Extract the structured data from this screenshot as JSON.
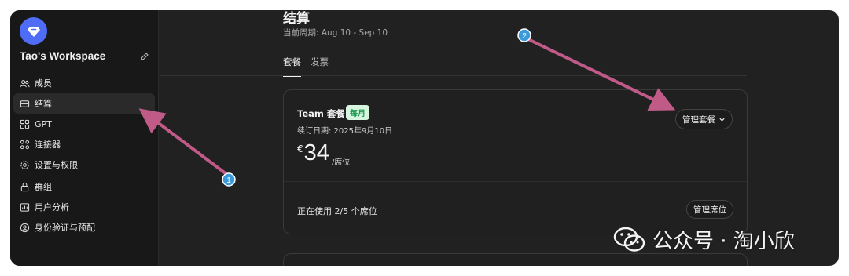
{
  "sidebar": {
    "workspace_name": "Tao's Workspace",
    "items": [
      {
        "label": "成员",
        "icon": "members-icon"
      },
      {
        "label": "结算",
        "icon": "card-icon",
        "active": true
      },
      {
        "label": "GPT",
        "icon": "gpt-icon"
      },
      {
        "label": "连接器",
        "icon": "connector-icon"
      },
      {
        "label": "设置与权限",
        "icon": "gear-icon"
      },
      {
        "label": "群组",
        "icon": "lock-icon"
      },
      {
        "label": "用户分析",
        "icon": "analytics-icon"
      },
      {
        "label": "身份验证与预配",
        "icon": "identity-icon"
      }
    ]
  },
  "main": {
    "title": "结算",
    "period": "当前周期: Aug 10 - Sep 10",
    "tabs": [
      {
        "label": "套餐",
        "active": true
      },
      {
        "label": "发票"
      }
    ],
    "plan": {
      "name": "Team 套餐",
      "badge": "每月",
      "renewal": "续订日期: 2025年9月10日",
      "currency": "€",
      "amount": "34",
      "per": "/席位",
      "manage_plan_label": "管理套餐",
      "seats_text": "正在使用 2/5 个席位",
      "manage_seats_label": "管理席位"
    }
  },
  "annotations": {
    "marker_1": "1",
    "marker_2": "2",
    "color": "#c05a86",
    "marker_color": "#3b9ad9"
  },
  "watermark": {
    "text": "公众号 · 淘小欣"
  },
  "colors": {
    "background": "#212121",
    "sidebar": "#181818",
    "accent_logo": "#4f6cf7",
    "badge_bg": "#d8f5e0",
    "badge_text": "#1f9d55"
  }
}
